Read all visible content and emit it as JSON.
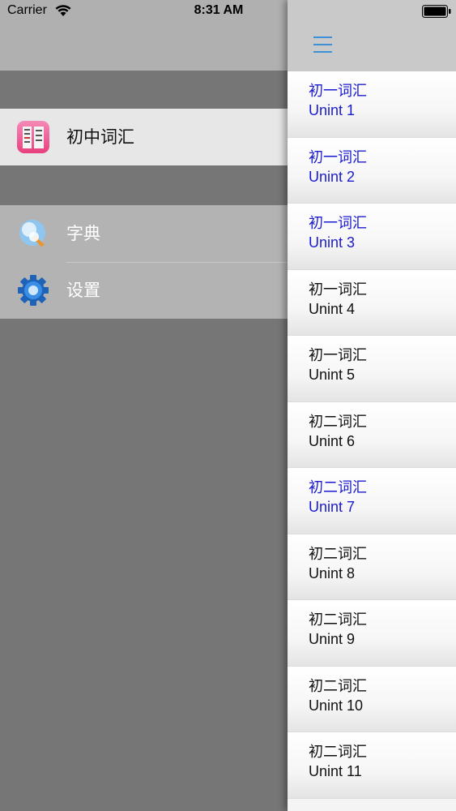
{
  "status_bar": {
    "carrier": "Carrier",
    "time": "8:31 AM"
  },
  "menu": {
    "primary_items": [
      {
        "label": "初中词汇",
        "icon": "vocabulary-book-icon",
        "selected": true
      }
    ],
    "secondary_items": [
      {
        "label": "字典",
        "icon": "dictionary-icon"
      },
      {
        "label": "设置",
        "icon": "gear-icon"
      }
    ]
  },
  "content": {
    "nav_icon": "hamburger-menu-icon",
    "units": [
      {
        "title": "初一词汇",
        "subtitle": "Unint 1",
        "color": "blue"
      },
      {
        "title": "初一词汇",
        "subtitle": "Unint 2",
        "color": "blue"
      },
      {
        "title": "初一词汇",
        "subtitle": "Unint 3",
        "color": "blue"
      },
      {
        "title": "初一词汇",
        "subtitle": "Unint 4",
        "color": "black"
      },
      {
        "title": "初一词汇",
        "subtitle": "Unint 5",
        "color": "black"
      },
      {
        "title": "初二词汇",
        "subtitle": "Unint 6",
        "color": "black"
      },
      {
        "title": "初二词汇",
        "subtitle": "Unint 7",
        "color": "blue"
      },
      {
        "title": "初二词汇",
        "subtitle": "Unint 8",
        "color": "black"
      },
      {
        "title": "初二词汇",
        "subtitle": "Unint 9",
        "color": "black"
      },
      {
        "title": "初二词汇",
        "subtitle": "Unint 10",
        "color": "black"
      },
      {
        "title": "初二词汇",
        "subtitle": "Unint 11",
        "color": "black"
      }
    ]
  },
  "colors": {
    "visited_blue": "#1a1ad0",
    "accent_blue": "#3d8fd6"
  }
}
